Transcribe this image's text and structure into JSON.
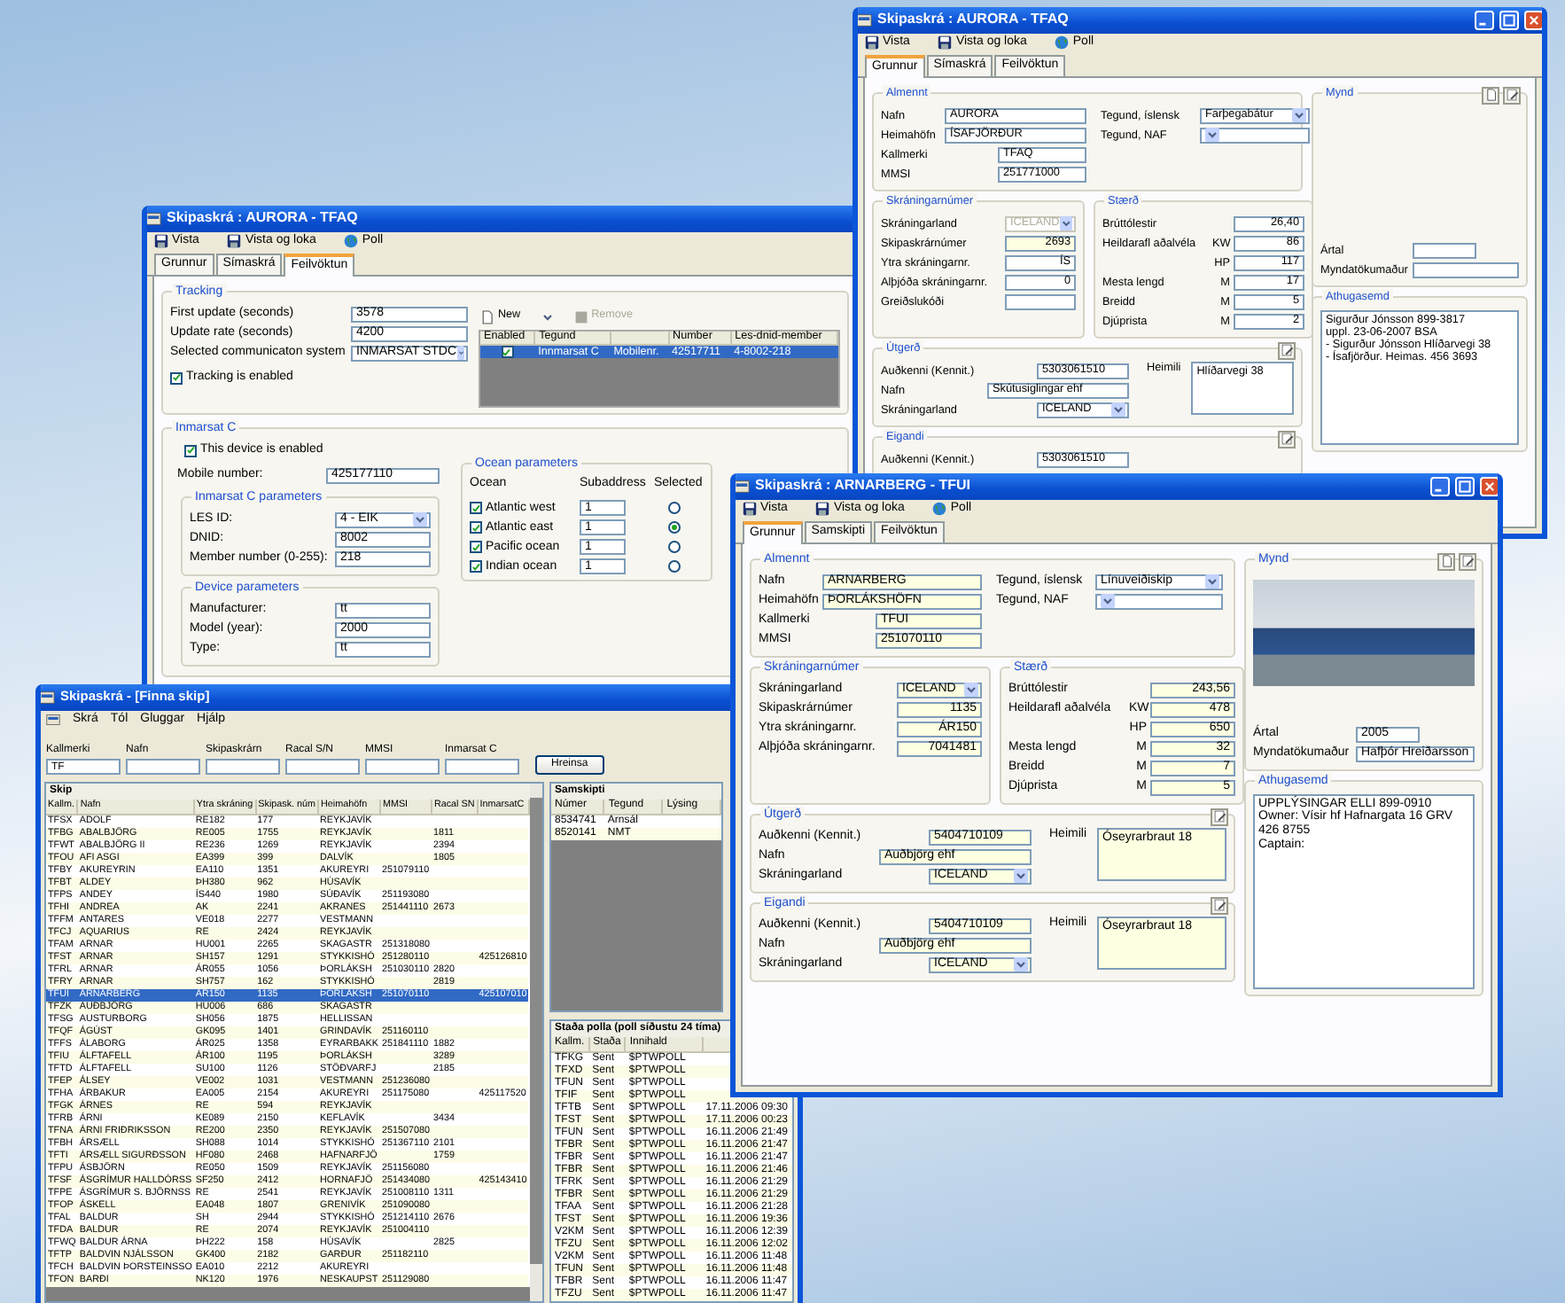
{
  "aurora_window": {
    "title": "Skipaskrá : AURORA - TFAQ",
    "title_buttons": true,
    "highlighted": false,
    "has_photo": false,
    "toolbar": [
      {
        "label": "Vista"
      },
      {
        "label": "Vista og loka"
      },
      {
        "label": "Poll"
      }
    ],
    "tabs": [
      {
        "label": "Grunnur",
        "selected": true
      },
      {
        "label": "Símaskrá",
        "selected": false
      },
      {
        "label": "Feilvöktun",
        "selected": false
      }
    ],
    "general": {
      "title": "Almennt",
      "fields": [
        {
          "label": "Nafn",
          "value": "AURORA"
        },
        {
          "label": "Heimahöfn",
          "value": "ÍSAFJÖRÐUR"
        },
        {
          "label": "Kallmerki",
          "value": "TFAQ"
        },
        {
          "label": "MMSI",
          "value": "251771000"
        }
      ],
      "types": [
        {
          "label": "Tegund, íslensk",
          "value": "Farþegabátur"
        },
        {
          "label": "Tegund, NAF"
        }
      ]
    },
    "registration": {
      "title": "Skráningarnúmer",
      "fields": [
        {
          "label": "Skráningarland",
          "value": "ICELAND",
          "kind": "select",
          "disabled": true,
          "highlighted": false
        },
        {
          "label": "Skipaskrárnúmer",
          "value": "2693",
          "kind": "text",
          "disabled": false,
          "highlighted": true
        },
        {
          "label": "Ytra skráningarnr.",
          "value": "ÍS",
          "kind": "text",
          "disabled": false,
          "highlighted": false
        },
        {
          "label": "Alþjóða skráningarnr.",
          "value": "0",
          "kind": "text",
          "disabled": false,
          "highlighted": false
        },
        {
          "label": "Greiðslukóði",
          "kind": "text",
          "disabled": false,
          "highlighted": false
        }
      ]
    },
    "size": {
      "title": "Stærð",
      "fields": [
        {
          "label": "Brúttólestir",
          "value": "26,40"
        },
        {
          "label": "Heildarafl aðalvéla",
          "unit": "KW",
          "value": "86"
        },
        {
          "unit": "HP",
          "value": "117"
        },
        {
          "label": "Mesta lengd",
          "unit": "M",
          "value": "17"
        },
        {
          "label": "Breidd",
          "unit": "M",
          "value": "5"
        },
        {
          "label": "Djúprista",
          "unit": "M",
          "value": "2"
        }
      ]
    },
    "operator": {
      "title": "Útgerð",
      "fields": [
        {
          "label": "Auðkenni (Kennit.)",
          "value": "5303061510"
        },
        {
          "label": "Nafn",
          "value": "Skútusiglingar ehf"
        },
        {
          "label": "Skráningarland",
          "value": "ICELAND",
          "kind": "select"
        }
      ],
      "address_label": "Heimili",
      "address": "Hlíðarvegi 38"
    },
    "owner": {
      "title": "Eigandi",
      "fields": [
        {
          "label": "Auðkenni (Kennit.)",
          "value": "5303061510"
        }
      ]
    },
    "photo": {
      "title": "Mynd",
      "fields": [
        {
          "label": "Ártal"
        },
        {
          "label": "Myndatökumaður"
        }
      ]
    },
    "notes": {
      "title": "Athugasemd",
      "lines": [
        "Sigurður Jónsson  899-3817",
        "uppl. 23-06-2007  BSA",
        "- Sigurður Jónsson Hlíðarvegi 38",
        "- Ísafjörður.  Heimas.  456 3693"
      ]
    }
  },
  "tracking_window": {
    "title": "Skipaskrá : AURORA - TFAQ",
    "title_buttons": false,
    "toolbar": [
      {
        "label": "Vista"
      },
      {
        "label": "Vista og loka"
      },
      {
        "label": "Poll"
      }
    ],
    "tabs": [
      {
        "label": "Grunnur",
        "selected": false
      },
      {
        "label": "Símaskrá",
        "selected": false
      },
      {
        "label": "Feilvöktun",
        "selected": true
      }
    ],
    "tracking": {
      "title": "Tracking",
      "fields": [
        {
          "label": "First update (seconds)",
          "value": "3578"
        },
        {
          "label": "Update rate (seconds)",
          "value": "4200"
        },
        {
          "label": "Selected communicaton system",
          "value": "INMARSAT STDC",
          "kind": "select"
        }
      ],
      "checkbox": {
        "label": "Tracking is enabled",
        "checked": true
      },
      "device_toolbar": [
        {
          "label": "New",
          "disabled": false
        },
        {
          "label": "Remove",
          "disabled": true
        }
      ],
      "devices": {
        "columns": [
          {
            "label": "Enabled"
          },
          {
            "label": "Tegund"
          },
          {},
          {
            "label": "Number"
          },
          {
            "label": "Les-dnid-member"
          }
        ],
        "rows": [
          {
            "enabled": true,
            "selected": true,
            "cells": [
              null,
              "Innmarsat C",
              "Mobilenr.",
              "42517711",
              "4-8002-218"
            ]
          }
        ]
      }
    },
    "inmarsat": {
      "title": "Inmarsat C",
      "checkbox": {
        "label": "This device is enabled",
        "checked": true
      },
      "mobile": {
        "label": "Mobile number:",
        "value": "425177110"
      },
      "parameters": {
        "title": "Inmarsat C parameters",
        "fields": [
          {
            "label": "LES ID:",
            "value": "4 - EIK",
            "kind": "select"
          },
          {
            "label": "DNID:",
            "value": "8002"
          },
          {
            "label": "Member number (0-255):",
            "value": "218"
          }
        ]
      },
      "device": {
        "title": "Device parameters",
        "fields": [
          {
            "label": "Manufacturer:",
            "value": "tt"
          },
          {
            "label": "Model (year):",
            "value": "2000"
          },
          {
            "label": "Type:",
            "value": "tt"
          }
        ]
      },
      "ocean": {
        "title": "Ocean parameters",
        "columns": [
          "Ocean",
          "Subaddress",
          "Selected"
        ],
        "rows": [
          {
            "name": "Atlantic west",
            "checked": true,
            "subaddress": "1",
            "selected": false
          },
          {
            "name": "Atlantic east",
            "checked": true,
            "subaddress": "1",
            "selected": true
          },
          {
            "name": "Pacific ocean",
            "checked": true,
            "subaddress": "1",
            "selected": false
          },
          {
            "name": "Indian ocean",
            "checked": true,
            "subaddress": "1",
            "selected": false
          }
        ]
      }
    }
  },
  "arnarberg_window": {
    "title": "Skipaskrá : ARNARBERG - TFUI",
    "title_buttons": true,
    "highlighted": true,
    "has_photo": true,
    "toolbar": [
      {
        "label": "Vista"
      },
      {
        "label": "Vista og loka"
      },
      {
        "label": "Poll"
      }
    ],
    "tabs": [
      {
        "label": "Grunnur",
        "selected": true
      },
      {
        "label": "Samskipti",
        "selected": false
      },
      {
        "label": "Feilvöktun",
        "selected": false
      }
    ],
    "general": {
      "title": "Almennt",
      "fields": [
        {
          "label": "Nafn",
          "value": "ARNARBERG"
        },
        {
          "label": "Heimahöfn",
          "value": "ÞORLÁKSHÖFN"
        },
        {
          "label": "Kallmerki",
          "value": "TFUI"
        },
        {
          "label": "MMSI",
          "value": "251070110"
        }
      ],
      "types": [
        {
          "label": "Tegund, íslensk",
          "value": "Línuveiðiskip"
        },
        {
          "label": "Tegund, NAF"
        }
      ]
    },
    "registration": {
      "title": "Skráningarnúmer",
      "fields": [
        {
          "label": "Skráningarland",
          "value": "ICELAND",
          "kind": "select",
          "disabled": false
        },
        {
          "label": "Skipaskrárnúmer",
          "value": "1135",
          "kind": "text",
          "disabled": false
        },
        {
          "label": "Ytra skráningarnr.",
          "value": "ÁR150",
          "kind": "text",
          "disabled": false
        },
        {
          "label": "Alþjóða skráningarnr.",
          "value": "7041481",
          "kind": "text",
          "disabled": false
        }
      ]
    },
    "size": {
      "title": "Stærð",
      "fields": [
        {
          "label": "Brúttólestir",
          "value": "243,56"
        },
        {
          "label": "Heildarafl aðalvéla",
          "unit": "KW",
          "value": "478"
        },
        {
          "unit": "HP",
          "value": "650"
        },
        {
          "label": "Mesta lengd",
          "unit": "M",
          "value": "32"
        },
        {
          "label": "Breidd",
          "unit": "M",
          "value": "7"
        },
        {
          "label": "Djúprista",
          "unit": "M",
          "value": "5"
        }
      ]
    },
    "operator": {
      "title": "Útgerð",
      "fields": [
        {
          "label": "Auðkenni (Kennit.)",
          "value": "5404710109"
        },
        {
          "label": "Nafn",
          "value": "Auðbjörg ehf"
        },
        {
          "label": "Skráningarland",
          "value": "ICELAND",
          "kind": "select"
        }
      ],
      "address_label": "Heimili",
      "address": "Óseyrarbraut 18"
    },
    "owner": {
      "title": "Eigandi",
      "fields": [
        {
          "label": "Auðkenni (Kennit.)",
          "value": "5404710109"
        },
        {
          "label": "Nafn",
          "value": "Auðbjörg ehf"
        },
        {
          "label": "Skráningarland",
          "value": "ICELAND",
          "kind": "select"
        }
      ],
      "address_label": "Heimili",
      "address": "Óseyrarbraut 18"
    },
    "photo": {
      "title": "Mynd",
      "fields": [
        {
          "label": "Ártal",
          "value": "2005"
        },
        {
          "label": "Myndatökumaður",
          "value": "Hafþór Hreiðarsson"
        }
      ]
    },
    "notes": {
      "title": "Athugasemd",
      "lines": [
        "UPPLÝSINGAR ELLI 899-0910",
        "Owner: Vísir hf Hafnargata 16 GRV 426 8755",
        "Captain:"
      ]
    }
  },
  "search_window": {
    "title": "Skipaskrá - [Finna skip]",
    "menu": [
      "Skrá",
      "Tól",
      "Gluggar",
      "Hjálp"
    ],
    "search_fields": [
      {
        "label": "Kallmerki",
        "value": "TF"
      },
      {
        "label": "Nafn"
      },
      {
        "label": "Skipaskrárn"
      },
      {
        "label": "Racal S/N"
      },
      {
        "label": "MMSI"
      },
      {
        "label": "Inmarsat C"
      }
    ],
    "clear_button": "Hreinsa",
    "ships": {
      "title": "Skip",
      "columns": [
        "Kallm.",
        "Nafn",
        "Ytra skráning",
        "Skipask. núm",
        "Heimahöfn",
        "MMSI",
        "Racal SN",
        "InmarsatC"
      ],
      "rows": [
        {
          "selected": false,
          "cells": [
            "TFSX",
            "ADOLF",
            "RE182",
            "177",
            "REYKJAVÍK",
            null,
            null,
            null
          ]
        },
        {
          "selected": false,
          "cells": [
            "TFBG",
            "ABALBJÖRG",
            "RE005",
            "1755",
            "REYKJAVÍK",
            null,
            "1811",
            null
          ]
        },
        {
          "selected": false,
          "cells": [
            "TFWT",
            "ABALBJÖRG II",
            "RE236",
            "1269",
            "REYKJAVÍK",
            null,
            "2394",
            null
          ]
        },
        {
          "selected": false,
          "cells": [
            "TFOU",
            "AFI ASGI",
            "EA399",
            "399",
            "DALVÍK",
            null,
            "1805",
            null
          ]
        },
        {
          "selected": false,
          "cells": [
            "TFBY",
            "AKUREYRIN",
            "EA110",
            "1351",
            "AKUREYRI",
            "251079110",
            null,
            null
          ]
        },
        {
          "selected": false,
          "cells": [
            "TFBT",
            "ALDEY",
            "ÞH380",
            "962",
            "HÚSAVÍK",
            null,
            null,
            null
          ]
        },
        {
          "selected": false,
          "cells": [
            "TFPS",
            "ANDEY",
            "ÍS440",
            "1980",
            "SÚÐAVÍK",
            "251193080",
            null,
            null
          ]
        },
        {
          "selected": false,
          "cells": [
            "TFHI",
            "ANDREA",
            "AK",
            "2241",
            "AKRANES",
            "251441110",
            "2673",
            null
          ]
        },
        {
          "selected": false,
          "cells": [
            "TFFM",
            "ANTARES",
            "VE018",
            "2277",
            "VESTMANN",
            null,
            null,
            null
          ]
        },
        {
          "selected": false,
          "cells": [
            "TFCJ",
            "AQUARIUS",
            "RE",
            "2424",
            "REYKJAVÍK",
            null,
            null,
            null
          ]
        },
        {
          "selected": false,
          "cells": [
            "TFAM",
            "ARNAR",
            "HU001",
            "2265",
            "SKAGASTR",
            "251318080",
            null,
            null
          ]
        },
        {
          "selected": false,
          "cells": [
            "TFST",
            "ARNAR",
            "SH157",
            "1291",
            "STYKKISHÓ",
            "251280110",
            null,
            "425126810"
          ]
        },
        {
          "selected": false,
          "cells": [
            "TFRL",
            "ARNAR",
            "ÁR055",
            "1056",
            "ÞORLÁKSH",
            "251030110",
            "2820",
            null
          ]
        },
        {
          "selected": false,
          "cells": [
            "TFRY",
            "ARNAR",
            "SH757",
            "162",
            "STYKKISHÓ",
            null,
            "2819",
            null
          ]
        },
        {
          "selected": true,
          "cells": [
            "TFUI",
            "ARNARBERG",
            "ÁR150",
            "1135",
            "ÞORLÁKSH",
            "251070110",
            null,
            "425107010"
          ]
        },
        {
          "selected": false,
          "cells": [
            "TFZK",
            "AUÐBJÖRG",
            "HU006",
            "686",
            "SKAGASTR",
            null,
            null,
            null
          ]
        },
        {
          "selected": false,
          "cells": [
            "TFSG",
            "AUSTURBORG",
            "SH056",
            "1875",
            "HELLISSAN",
            null,
            null,
            null
          ]
        },
        {
          "selected": false,
          "cells": [
            "TFQF",
            "ÁGÚST",
            "GK095",
            "1401",
            "GRINDAVÍK",
            "251160110",
            null,
            null
          ]
        },
        {
          "selected": false,
          "cells": [
            "TFFS",
            "ÁLABORG",
            "ÁR025",
            "1358",
            "EYRARBAKK",
            "251841110",
            "1882",
            null
          ]
        },
        {
          "selected": false,
          "cells": [
            "TFIU",
            "ÁLFTAFELL",
            "ÁR100",
            "1195",
            "ÞORLÁKSH",
            null,
            "3289",
            null
          ]
        },
        {
          "selected": false,
          "cells": [
            "TFTD",
            "ÁLFTAFELL",
            "SU100",
            "1126",
            "STÖÐVARFJ",
            null,
            "2185",
            null
          ]
        },
        {
          "selected": false,
          "cells": [
            "TFEP",
            "ÁLSEY",
            "VE002",
            "1031",
            "VESTMANN",
            "251236080",
            null,
            null
          ]
        },
        {
          "selected": false,
          "cells": [
            "TFHA",
            "ÁRBAKUR",
            "EA005",
            "2154",
            "AKUREYRI",
            "251175080",
            null,
            "425117520"
          ]
        },
        {
          "selected": false,
          "cells": [
            "TFGK",
            "ÁRNES",
            "RE",
            "594",
            "REYKJAVÍK",
            null,
            null,
            null
          ]
        },
        {
          "selected": false,
          "cells": [
            "TFRB",
            "ÁRNI",
            "KE089",
            "2150",
            "KEFLAVÍK",
            null,
            "3434",
            null
          ]
        },
        {
          "selected": false,
          "cells": [
            "TFNA",
            "ÁRNI FRIÐRIKSSON",
            "RE200",
            "2350",
            "REYKJAVÍK",
            "251507080",
            null,
            null
          ]
        },
        {
          "selected": false,
          "cells": [
            "TFBH",
            "ÁRSÆLL",
            "SH088",
            "1014",
            "STYKKISHÓ",
            "251367110",
            "2101",
            null
          ]
        },
        {
          "selected": false,
          "cells": [
            "TFTI",
            "ÁRSÆLL SIGURÐSSON",
            "HF080",
            "2468",
            "HAFNARFJÖ",
            null,
            "1759",
            null
          ]
        },
        {
          "selected": false,
          "cells": [
            "TFPU",
            "ÁSBJÖRN",
            "RE050",
            "1509",
            "REYKJAVÍK",
            "251156080",
            null,
            null
          ]
        },
        {
          "selected": false,
          "cells": [
            "TFSF",
            "ÁSGRÍMUR HALLDÓRSS",
            "SF250",
            "2412",
            "HORNAFJÖ",
            "251434080",
            null,
            "425143410"
          ]
        },
        {
          "selected": false,
          "cells": [
            "TFPE",
            "ÁSGRÍMUR S. BJÖRNSS",
            "RE",
            "2541",
            "REYKJAVÍK",
            "251008110",
            "1311",
            null
          ]
        },
        {
          "selected": false,
          "cells": [
            "TFOP",
            "ÁSKELL",
            "EA048",
            "1807",
            "GRENIVÍK",
            "251090080",
            null,
            null
          ]
        },
        {
          "selected": false,
          "cells": [
            "TFAL",
            "BALDUR",
            "SH",
            "2944",
            "STYKKISHÓ",
            "251214110",
            "2676",
            null
          ]
        },
        {
          "selected": false,
          "cells": [
            "TFDA",
            "BALDUR",
            "RE",
            "2074",
            "REYKJAVÍK",
            "251004110",
            null,
            null
          ]
        },
        {
          "selected": false,
          "cells": [
            "TFWQ",
            "BALDUR ÁRNA",
            "ÞH222",
            "158",
            "HÚSAVÍK",
            null,
            "2825",
            null
          ]
        },
        {
          "selected": false,
          "cells": [
            "TFTP",
            "BALDVIN NJÁLSSON",
            "GK400",
            "2182",
            "GARÐUR",
            "251182110",
            null,
            null
          ]
        },
        {
          "selected": false,
          "cells": [
            "TFCH",
            "BALDVIN ÞORSTEINSSO",
            "EA010",
            "2212",
            "AKUREYRI",
            null,
            null,
            null
          ]
        },
        {
          "selected": false,
          "cells": [
            "TFON",
            "BARÐI",
            "NK120",
            "1976",
            "NESKAUPST",
            "251129080",
            null,
            null
          ]
        }
      ]
    },
    "communications": {
      "title": "Samskipti",
      "columns": [
        "Númer",
        "Tegund",
        "Lýsing"
      ],
      "rows": [
        [
          "8534741",
          "Arnsál"
        ],
        [
          "8520141",
          "NMT"
        ]
      ]
    },
    "polls": {
      "title": "Staða polla  (poll síðustu 24 tíma)",
      "columns": [
        "Kallm.",
        "Staða",
        "Innihald"
      ],
      "rows": [
        [
          "TFKG",
          "Sent",
          "$PTWPOLL"
        ],
        [
          "TFXD",
          "Sent",
          "$PTWPOLL"
        ],
        [
          "TFUN",
          "Sent",
          "$PTWPOLL"
        ],
        [
          "TFIF",
          "Sent",
          "$PTWPOLL"
        ],
        [
          "TFTB",
          "Sent",
          "$PTWPOLL",
          "17.11.2006 09:30"
        ],
        [
          "TFST",
          "Sent",
          "$PTWPOLL",
          "17.11.2006 00:23"
        ],
        [
          "TFUN",
          "Sent",
          "$PTWPOLL",
          "16.11.2006 21:49"
        ],
        [
          "TFBR",
          "Sent",
          "$PTWPOLL",
          "16.11.2006 21:47"
        ],
        [
          "TFBR",
          "Sent",
          "$PTWPOLL",
          "16.11.2006 21:47"
        ],
        [
          "TFBR",
          "Sent",
          "$PTWPOLL",
          "16.11.2006 21:46"
        ],
        [
          "TFRK",
          "Sent",
          "$PTWPOLL",
          "16.11.2006 21:29"
        ],
        [
          "TFBR",
          "Sent",
          "$PTWPOLL",
          "16.11.2006 21:29"
        ],
        [
          "TFAA",
          "Sent",
          "$PTWPOLL",
          "16.11.2006 21:28"
        ],
        [
          "TFST",
          "Sent",
          "$PTWPOLL",
          "16.11.2006 19:36"
        ],
        [
          "V2KM",
          "Sent",
          "$PTWPOLL",
          "16.11.2006 12:39"
        ],
        [
          "TFZU",
          "Sent",
          "$PTWPOLL",
          "16.11.2006 12:02"
        ],
        [
          "V2KM",
          "Sent",
          "$PTWPOLL",
          "16.11.2006 11:48"
        ],
        [
          "TFUN",
          "Sent",
          "$PTWPOLL",
          "16.11.2006 11:48"
        ],
        [
          "TFBR",
          "Sent",
          "$PTWPOLL",
          "16.11.2006 11:47"
        ],
        [
          "TFZU",
          "Sent",
          "$PTWPOLL",
          "16.11.2006 11:47"
        ]
      ]
    }
  }
}
